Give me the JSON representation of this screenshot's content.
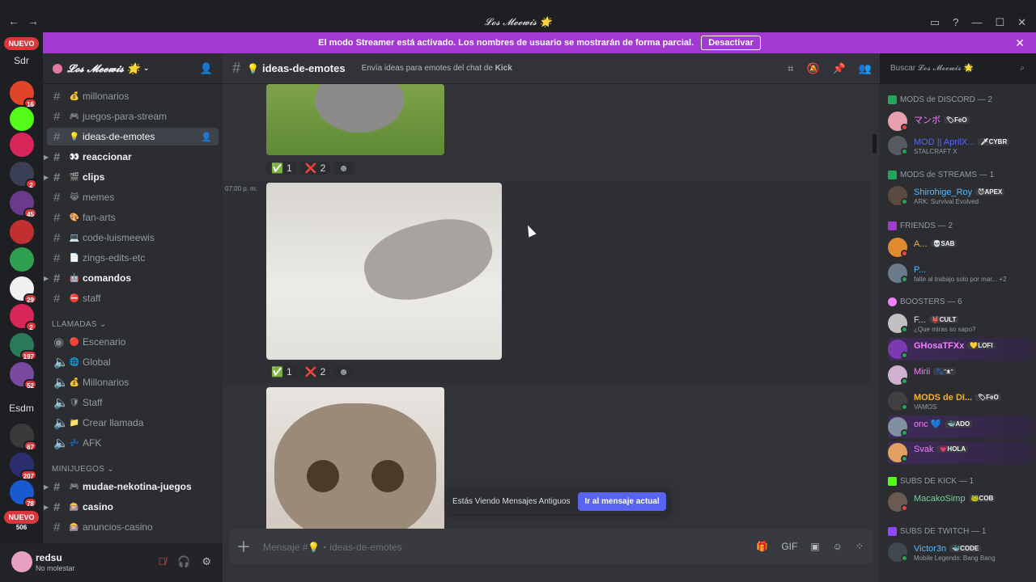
{
  "window": {
    "title": "𝓛𝓸𝓼 𝓜𝓮𝓮𝔀𝓲𝓼 🌟",
    "back": "←",
    "forward": "→",
    "controls": [
      "▭",
      "?",
      "—",
      "☐",
      "✕"
    ]
  },
  "banner": {
    "text": "El modo Streamer está activado. Los nombres de usuario se mostrarán de forma parcial.",
    "button": "Desactivar",
    "close": "✕",
    "color": "#a33ad0"
  },
  "rail": {
    "top_pill": "NUEVO",
    "sdr": "Sdr",
    "esdm": "Esdm",
    "bottom_pill": "NUEVO",
    "badges": [
      "16",
      "2",
      "45",
      "29",
      "2",
      "197",
      "52",
      "67",
      "207",
      "78",
      "506"
    ]
  },
  "sidebar": {
    "server_name": "𝓛𝓸𝓼 𝓜𝓮𝓮𝔀𝓲𝓼 🌟",
    "channels": [
      {
        "label": "millonarios",
        "icon": "💰"
      },
      {
        "label": "juegos-para-stream",
        "icon": "🎮"
      },
      {
        "label": "ideas-de-emotes",
        "icon": "💡"
      },
      {
        "label": "reaccionar",
        "icon": "👀"
      },
      {
        "label": "clips",
        "icon": "🎬"
      },
      {
        "label": "memes",
        "icon": "😹"
      },
      {
        "label": "fan-arts",
        "icon": "🎨"
      },
      {
        "label": "code-luismeewis",
        "icon": "💻"
      },
      {
        "label": "zings-edits-etc",
        "icon": "📄"
      },
      {
        "label": "comandos",
        "icon": "🤖"
      },
      {
        "label": "staff",
        "icon": "⛔"
      }
    ],
    "cat_calls": "LLAMADAS",
    "voice": [
      {
        "label": "Escenario",
        "icon": "🔴"
      },
      {
        "label": "Global",
        "icon": "🌐"
      },
      {
        "label": "Millonarios",
        "icon": "💰"
      },
      {
        "label": "Staff",
        "icon": "🛡"
      },
      {
        "label": "Crear llamada",
        "icon": "📁"
      },
      {
        "label": "AFK",
        "icon": "💤"
      }
    ],
    "cat_games": "MINIJUEGOS",
    "games": [
      {
        "label": "mudae-nekotina-juegos",
        "icon": "🎮"
      },
      {
        "label": "casino",
        "icon": "🎰"
      },
      {
        "label": "anuncios-casino",
        "icon": "🎰"
      }
    ]
  },
  "user": {
    "name": "redsu",
    "status": "No molestar"
  },
  "channel": {
    "name": "ideas-de-emotes",
    "icon": "💡",
    "topic_prefix": "Envía ideas para emotes del chat de ",
    "topic_bold": "Kick"
  },
  "messages": {
    "timestamp": "07:00 p. m.",
    "reactions": [
      {
        "emoji": "✅",
        "count": "1"
      },
      {
        "emoji": "❌",
        "count": "2"
      }
    ]
  },
  "jump": {
    "text": "Estás Viendo Mensajes Antiguos",
    "button": "Ir al mensaje actual"
  },
  "composer": {
    "placeholder": "Mensaje #💡・ideas-de-emotes"
  },
  "search": {
    "placeholder": "Buscar 𝓛𝓸𝓼 𝓜𝓮𝓮𝔀𝓲𝓼 🌟"
  },
  "members": {
    "groups": [
      {
        "title": "MODS de DISCORD — 2"
      },
      {
        "title": "MODS de STREAMS — 1"
      },
      {
        "title": "FRIENDS — 2"
      },
      {
        "title": "BOOSTERS — 6"
      },
      {
        "title": "SUBS DE KICK — 1"
      },
      {
        "title": "SUBS DE TWITCH — 1"
      }
    ],
    "list": [
      {
        "name": "マンボ",
        "tag": "🏷FeO",
        "sub": "",
        "color": "#f47fff"
      },
      {
        "name": "MOD || AprilX...",
        "tag": "🗡CYBR",
        "sub": "STALCRAFT X",
        "color": "#5865f2"
      },
      {
        "name": "Shirohige_Roy",
        "tag": "😈APEX",
        "sub": "ARK: Survival Evolved",
        "color": "#58b9ff"
      },
      {
        "name": "A...",
        "tag": "💀SAB",
        "sub": "",
        "color": "#f0b232"
      },
      {
        "name": "P...",
        "tag": "",
        "sub": "falte al trabajo solo por mar...",
        "more": "+2",
        "color": "#58b9ff"
      },
      {
        "name": "F...",
        "tag": "👹CULT",
        "sub": "¿Que miras so sapo?",
        "color": "#dbdee1"
      },
      {
        "name": "GHosaTFXx",
        "tag": "💛LOFI",
        "sub": "",
        "color": "#f47fff"
      },
      {
        "name": "Mirii",
        "tag": "🐾ᵔᴥᵔ",
        "sub": "",
        "color": "#f47fff"
      },
      {
        "name": "MODS de DI...",
        "tag": "🏷FeO",
        "sub": "VAMOS",
        "color": "#f0b232"
      },
      {
        "name": "onc 💙",
        "tag": "🐳ADO",
        "sub": "",
        "color": "#f47fff"
      },
      {
        "name": "Svak",
        "tag": "💗HOLA",
        "sub": "",
        "color": "#f47fff"
      },
      {
        "name": "MacakoSimp",
        "tag": "🐸COB",
        "sub": "",
        "color": "#7ec8a0"
      },
      {
        "name": "Victor3n",
        "tag": "🐳CODE",
        "sub": "Mobile Legends: Bang Bang",
        "color": "#58b9ff"
      }
    ]
  }
}
